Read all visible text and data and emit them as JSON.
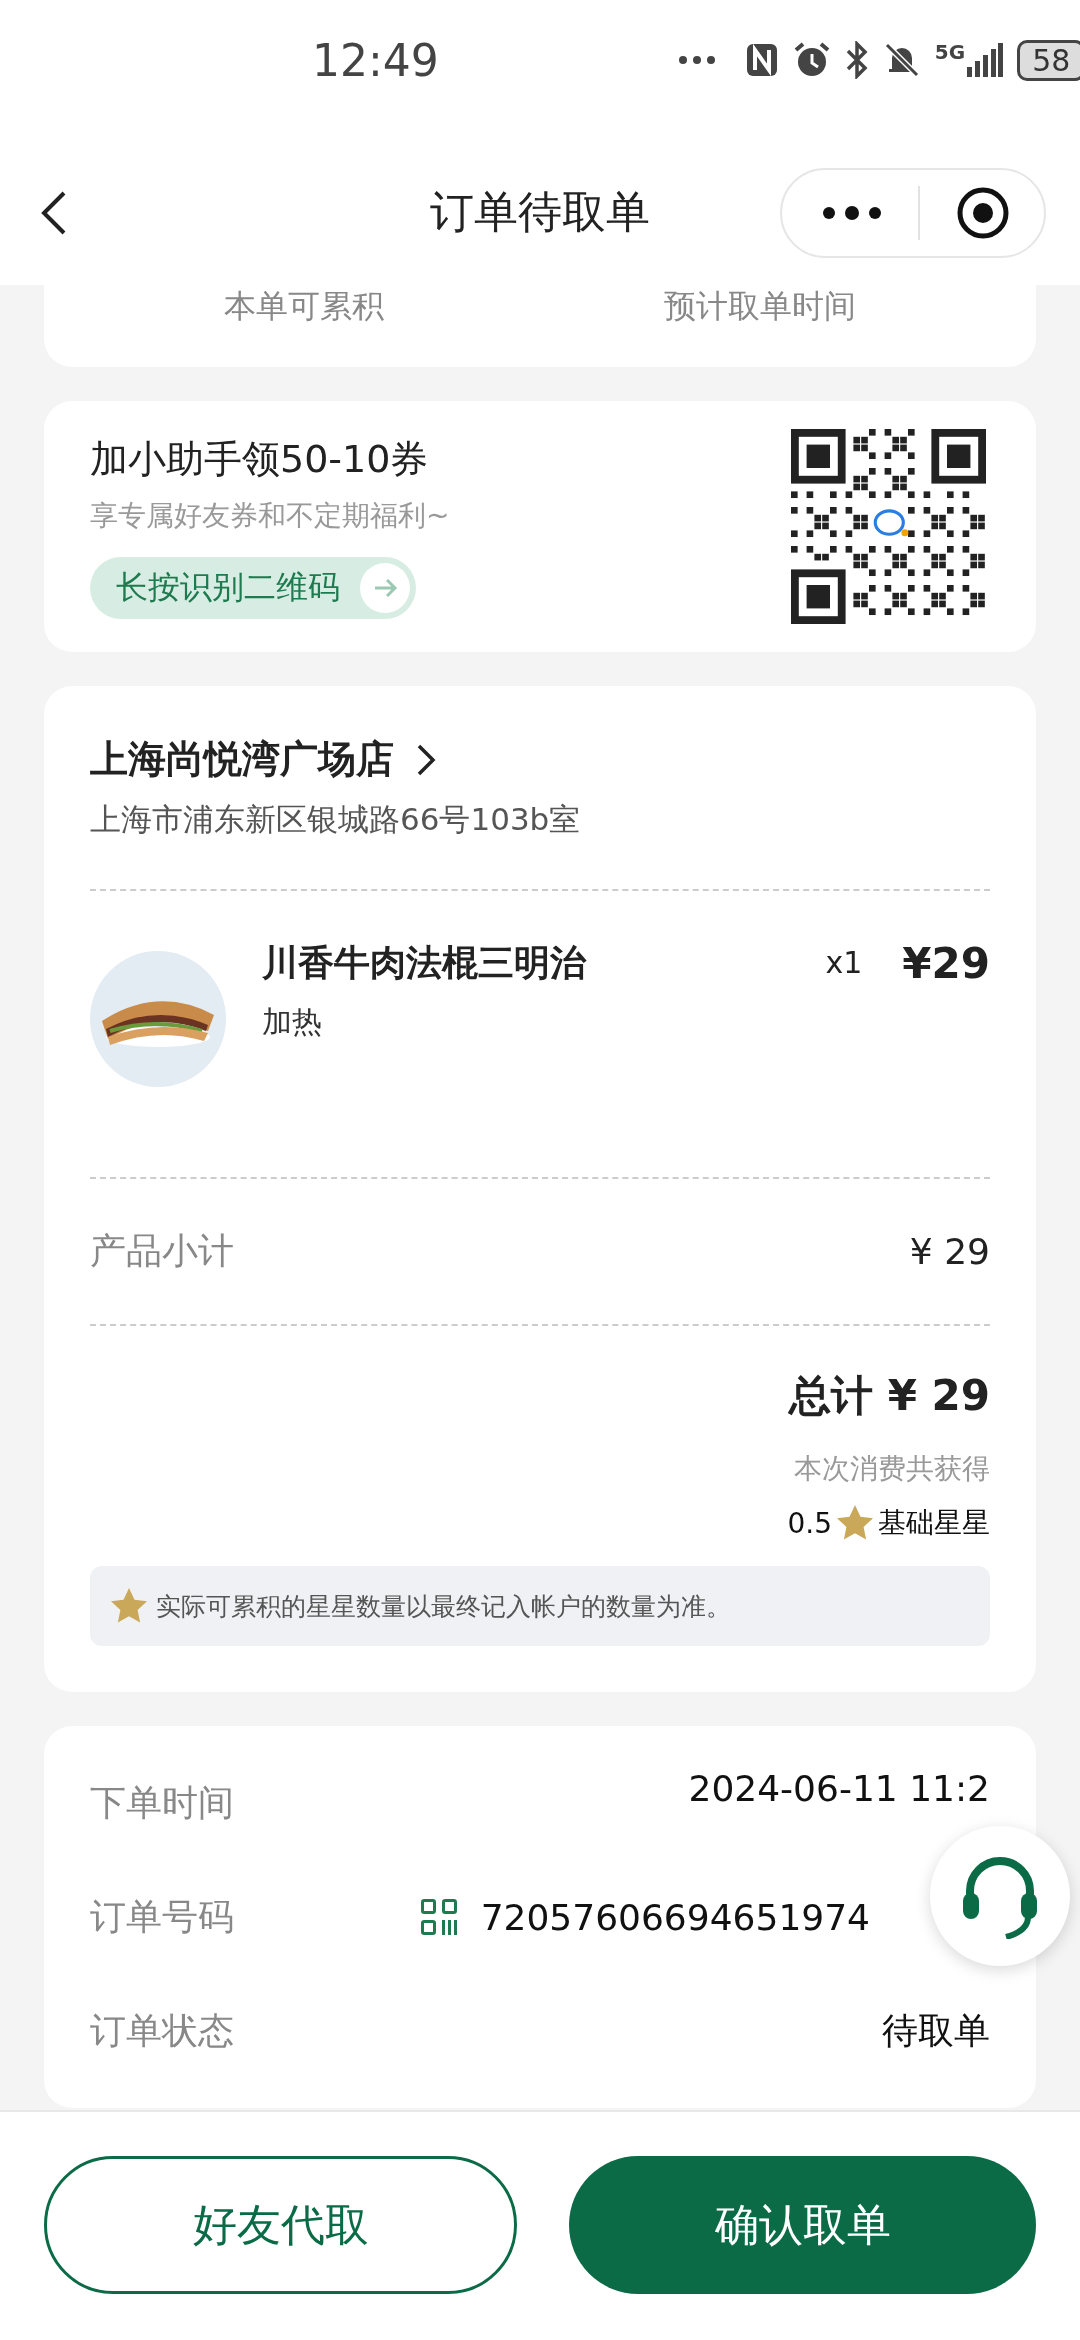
{
  "status_bar": {
    "time": "12:49",
    "network": "5G",
    "battery": "58"
  },
  "header": {
    "title": "订单待取单"
  },
  "summary_card": {
    "labels": [
      "本单可累积",
      "预计取单时间"
    ]
  },
  "assistant_card": {
    "title": "加小助手领50-10券",
    "subtitle": "享专属好友券和不定期福利~",
    "button": "长按识别二维码"
  },
  "order_card": {
    "store": "上海尚悦湾广场店",
    "address": "上海市浦东新区银城路66号103b室",
    "items": [
      {
        "name": "川香牛肉法棍三明治",
        "option": "加热",
        "quantity": "x1",
        "price": "¥29"
      }
    ],
    "subtotal_label": "产品小计",
    "subtotal": "¥ 29",
    "total": "总计 ¥ 29",
    "earn_label": "本次消费共获得",
    "stars_amount": "0.5",
    "stars_type": "基础星星",
    "note": "实际可累积的星星数量以最终记入帐户的数量为准。"
  },
  "details": [
    {
      "label": "下单时间",
      "value": "2024-06-11 11:2",
      "kind": "text"
    },
    {
      "label": "订单号码",
      "value": "72057606694651974",
      "kind": "code"
    },
    {
      "label": "订单状态",
      "value": "待取单",
      "kind": "text"
    }
  ],
  "buttons": [
    {
      "label": "好友代取",
      "kind": "outline"
    },
    {
      "label": "确认取单",
      "kind": "filled"
    }
  ]
}
